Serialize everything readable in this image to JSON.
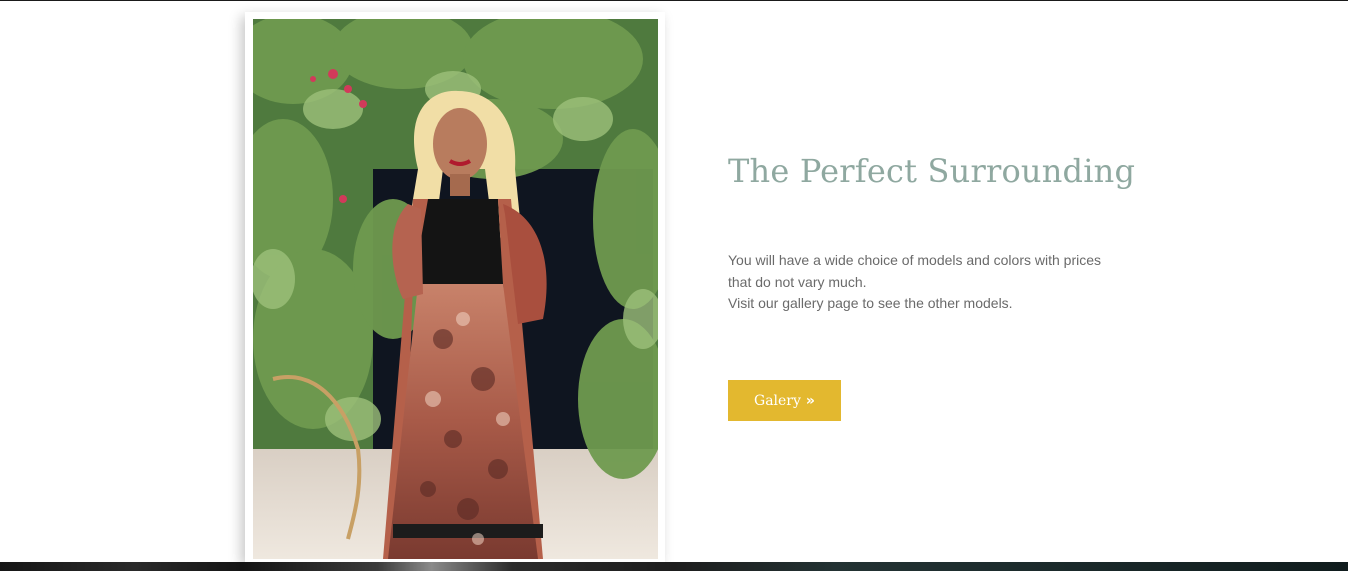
{
  "section": {
    "title": "The Perfect Surrounding",
    "description_lines": [
      "You will have a wide choice of models and colors with prices",
      "that do not vary much.",
      "Visit our gallery page to see the other models."
    ]
  },
  "gallery_button": {
    "label": "Galery",
    "icon": "double-chevron-right-icon",
    "icon_glyph": "»",
    "color": "#e3b82f"
  },
  "colors": {
    "title": "#8fa8a0",
    "body_text": "#6a6a6a",
    "button_bg": "#e3b82f",
    "button_text": "#ffffff"
  }
}
